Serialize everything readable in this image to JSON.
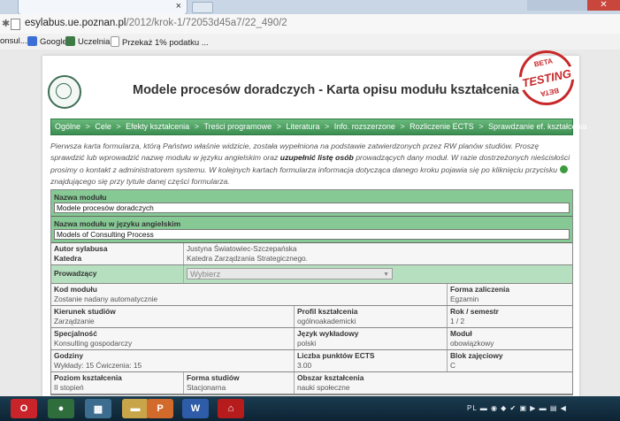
{
  "browser": {
    "tab_close": "×",
    "url_host": "esylabus.ue.poznan.pl",
    "url_path": "/2012/krok-1/72053d45a7/22_490/2"
  },
  "bookmarks": [
    {
      "label": "onsul...",
      "icon": "generic-icon",
      "color": "#9aa7b3"
    },
    {
      "label": "Google",
      "icon": "google-icon",
      "color": "#3b6fd6"
    },
    {
      "label": "Uczelnia",
      "icon": "folder-icon",
      "color": "#3d7a45"
    },
    {
      "label": "Przekaż 1% podatku ...",
      "icon": "page-icon",
      "color": "#dddddd"
    }
  ],
  "page": {
    "title": "Modele procesów doradczych - Karta opisu modułu kształcenia",
    "beta_top": "BETA",
    "beta_mid": "TESTING",
    "beta_bottom": "BETA",
    "nav": [
      "Ogólne",
      "Cele",
      "Efekty kształcenia",
      "Treści programowe",
      "Literatura",
      "Info. rozszerzone",
      "Rozliczenie ECTS",
      "Sprawdzanie ef. kształcenia"
    ],
    "nav_separator": ">",
    "intro_1": "Pierwsza karta formularza, którą Państwo właśnie widzicie, została wypełniona na podstawie zatwierdzonych przez RW planów studiów. Proszę sprawdzić lub wprowadzić nazwę modułu w języku angielskim oraz ",
    "intro_bold": "uzupełnić listę osób",
    "intro_2": " prowadzących dany moduł. W razie dostrzeżonych nieścisłości prosimy o kontakt z administratorem systemu. W kolejnych kartach formularza informacja dotycząca danego kroku pojawia się po kliknięciu przycisku ",
    "intro_3": " znajdującego się przy tytule danej części formularza."
  },
  "form": {
    "module_name_label": "Nazwa modułu",
    "module_name_value": "Modele procesów doradczych",
    "module_name_en_label": "Nazwa modułu w języku angielskim",
    "module_name_en_value": "Models of Consulting Process",
    "author_label": "Autor sylabusa",
    "dept_label": "Katedra",
    "author_value": "Justyna Światowiec-Szczepańska",
    "dept_value": "Katedra Zarządzania Strategicznego.",
    "lecturers_label": "Prowadzący",
    "lecturers_select": "Wybierz",
    "code_label": "Kod modułu",
    "code_value": "Zostanie nadany automatycznie",
    "credit_form_label": "Forma zaliczenia",
    "credit_form_value": "Egzamin",
    "field_label": "Kierunek studiów",
    "field_value": "Zarządzanie",
    "profile_label": "Profil kształcenia",
    "profile_value": "ogólnoakademicki",
    "year_label": "Rok / semestr",
    "year_value": "1 / 2",
    "spec_label": "Specjalność",
    "spec_value": "Konsulting gospodarczy",
    "lang_label": "Język wykładowy",
    "lang_value": "polski",
    "module_label": "Moduł",
    "module_value": "obowiązkowy",
    "hours_label": "Godziny",
    "hours_value": "Wykłady: 15 Ćwiczenia: 15",
    "ects_label": "Liczba punktów ECTS",
    "ects_value": "3.00",
    "block_label": "Blok zajęciowy",
    "block_value": "C",
    "level_label": "Poziom kształcenia",
    "level_value": "II stopień",
    "study_form_label": "Forma studiów",
    "study_form_value": "Stacjonarna",
    "area_label": "Obszar kształcenia",
    "area_value": "nauki społeczne"
  },
  "taskbar": {
    "apps": [
      "opera-icon",
      "chrome-icon",
      "explorer-icon",
      "folder-icon",
      "powerpoint-icon",
      "word-icon",
      "acrobat-icon"
    ],
    "tray_lang": "PL"
  }
}
